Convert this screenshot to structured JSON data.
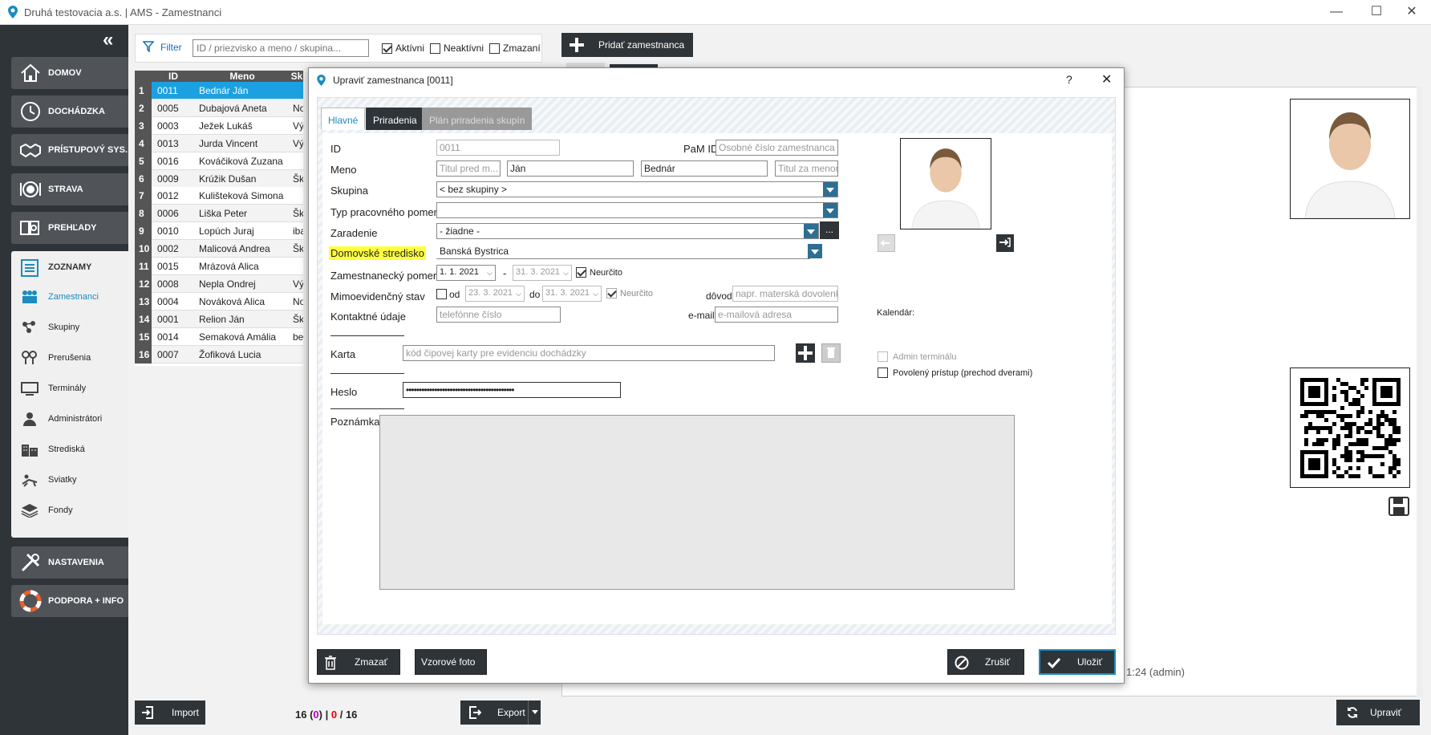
{
  "window": {
    "title": "Druhá testovacia a.s. | AMS - Zamestnanci",
    "minimize": "—",
    "maximize": "☐",
    "close": "✕"
  },
  "sidebar": {
    "collapse": "«",
    "modules": [
      "DOMOV",
      "DOCHÁDZKA",
      "PRÍSTUPOVÝ SYS.",
      "STRAVA",
      "PREHĽADY"
    ],
    "section_title": "ZOZNAMY",
    "subitems": [
      "Zamestnanci",
      "Skupiny",
      "Prerušenia",
      "Terminály",
      "Administrátori",
      "Strediská",
      "Sviatky",
      "Fondy"
    ],
    "bottom_modules": [
      "NASTAVENIA",
      "PODPORA + INFO"
    ]
  },
  "list": {
    "filter_label": "Filter",
    "filter_placeholder": "ID / priezvisko a meno / skupina...",
    "checks": [
      {
        "label": "Aktívni",
        "checked": true
      },
      {
        "label": "Neaktívni",
        "checked": false
      },
      {
        "label": "Zmazaní",
        "checked": false
      }
    ],
    "add_label": "Pridať zamestnanca",
    "headers": [
      "ID",
      "Meno",
      "Sk"
    ],
    "rows": [
      {
        "n": "1",
        "id": "0011",
        "name": "Bednár Ján",
        "group": ""
      },
      {
        "n": "2",
        "id": "0005",
        "name": "Dubajová Aneta",
        "group": "Nočná"
      },
      {
        "n": "3",
        "id": "0003",
        "name": "Ježek Lukáš",
        "group": "Výroba"
      },
      {
        "n": "4",
        "id": "0013",
        "name": "Jurda Vincent",
        "group": "Výroba"
      },
      {
        "n": "5",
        "id": "0016",
        "name": "Kováčiková Zuzana",
        "group": ""
      },
      {
        "n": "6",
        "id": "0009",
        "name": "Krúžik Dušan",
        "group": "Škola"
      },
      {
        "n": "7",
        "id": "0012",
        "name": "Kulišteková Simona",
        "group": ""
      },
      {
        "n": "8",
        "id": "0006",
        "name": "Liška Peter",
        "group": "Škola"
      },
      {
        "n": "9",
        "id": "0010",
        "name": "Lopúch Juraj",
        "group": "iba pe"
      },
      {
        "n": "10",
        "id": "0002",
        "name": "Malicová Andrea",
        "group": "Škola"
      },
      {
        "n": "11",
        "id": "0015",
        "name": "Mrázová Alica",
        "group": ""
      },
      {
        "n": "12",
        "id": "0008",
        "name": "Nepla Ondrej",
        "group": "Výroba"
      },
      {
        "n": "13",
        "id": "0004",
        "name": "Nováková Alica",
        "group": "Nočná"
      },
      {
        "n": "14",
        "id": "0001",
        "name": "Relion Ján",
        "group": "Škola"
      },
      {
        "n": "15",
        "id": "0014",
        "name": "Semaková Amália",
        "group": "bez zm"
      },
      {
        "n": "16",
        "id": "0007",
        "name": "Žofiková Lucia",
        "group": ""
      }
    ],
    "import_label": "Import",
    "export_label": "Export",
    "counter": {
      "a": "16",
      "open": " (",
      "b": "0",
      "close": ") | ",
      "c": "0",
      "sep": " / ",
      "d": "16"
    }
  },
  "detail": {
    "timestamp": "1:24 (admin)",
    "upravit_label": "Upraviť"
  },
  "dialog": {
    "title": "Upraviť zamestnanca [0011]",
    "help": "?",
    "close": "✕",
    "tabs": [
      "Hlavné",
      "Priradenia",
      "Plán priradenia skupín"
    ],
    "labels": {
      "id": "ID",
      "meno": "Meno",
      "skupina": "Skupina",
      "typ": "Typ pracovného pomeru",
      "zaradenie": "Zaradenie",
      "stredisko": "Domovské stredisko",
      "pomer": "Zamestnanecký pomer",
      "mimo": "Mimoevidenčný stav",
      "kontakt": "Kontaktné údaje",
      "karta": "Karta",
      "heslo": "Heslo",
      "poznamka": "Poznámka:",
      "pam": "PaM ID:",
      "od": "od",
      "do": "do",
      "dovod": "dôvod",
      "email": "e-mail",
      "kalendar": "Kalendár:",
      "neurcito": "Neurčito",
      "dash": "-",
      "dots": "..."
    },
    "values": {
      "id": "0011",
      "titul_pred_ph": "Titul pred m...",
      "meno": "Ján",
      "priezvisko": "Bednár",
      "titul_za_ph": "Titul za menom",
      "pam_ph": "Osobné číslo zamestnanca ...",
      "skupina": "< bez skupiny >",
      "typ": "",
      "zaradenie": "- žiadne -",
      "stredisko": "Banská Bystrica",
      "pomer_od": "1. 1. 2021",
      "pomer_do": "31. 3. 2021",
      "mimo_od": "23. 3. 2021",
      "mimo_do": "31. 3. 2021",
      "dovod_ph": "napr. materská dovolenka",
      "tel_ph": "telefónne číslo",
      "email_ph": "e-mailová adresa",
      "karta_ph": "kód čipovej karty pre evidenciu dochádzky",
      "heslo": "••••••••••••••••••••••••••••••••••••••••••",
      "admin_terminal": "Admin terminálu",
      "povoleny": "Povolený prístup (prechod dverami)"
    },
    "buttons": {
      "zmazat": "Zmazať",
      "foto": "Vzorové foto",
      "zrusit": "Zrušiť",
      "ulozit": "Uložiť"
    }
  }
}
